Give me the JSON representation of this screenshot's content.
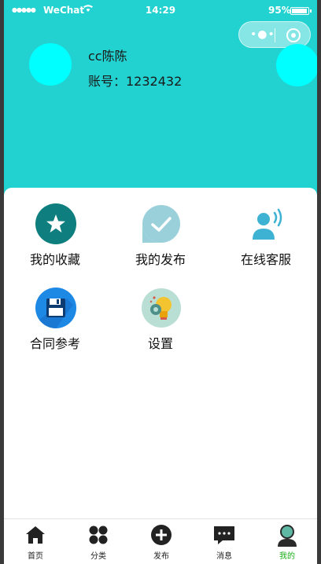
{
  "status_bar": {
    "signal": "●●●●●",
    "carrier": "WeChat",
    "time": "14:29",
    "battery": "95%"
  },
  "capsule": {
    "more_icon": "more-dots-icon",
    "close_icon": "target-icon"
  },
  "profile": {
    "name": "cc陈陈",
    "account": "账号：1232432"
  },
  "menu": [
    {
      "label": "我的收藏",
      "icon": "star-icon",
      "color": "#0e7e7e"
    },
    {
      "label": "我的发布",
      "icon": "check-bubble-icon",
      "color": "#9ad0da"
    },
    {
      "label": "在线客服",
      "icon": "support-person-icon",
      "color": "#3eb2d2"
    },
    {
      "label": "合同参考",
      "icon": "floppy-disk-icon",
      "color": "#1e88e5"
    },
    {
      "label": "设置",
      "icon": "settings-gear-bulb-icon",
      "color": "#b9ded4"
    }
  ],
  "tabs": [
    {
      "label": "首页",
      "icon": "home-icon"
    },
    {
      "label": "分类",
      "icon": "grid-icon"
    },
    {
      "label": "发布",
      "icon": "plus-circle-icon"
    },
    {
      "label": "消息",
      "icon": "message-icon"
    },
    {
      "label": "我的",
      "icon": "user-icon",
      "active": true
    }
  ],
  "colors": {
    "header": "#22d2d0",
    "avatar": "#00ffff",
    "active_tab": "#1aad19"
  }
}
